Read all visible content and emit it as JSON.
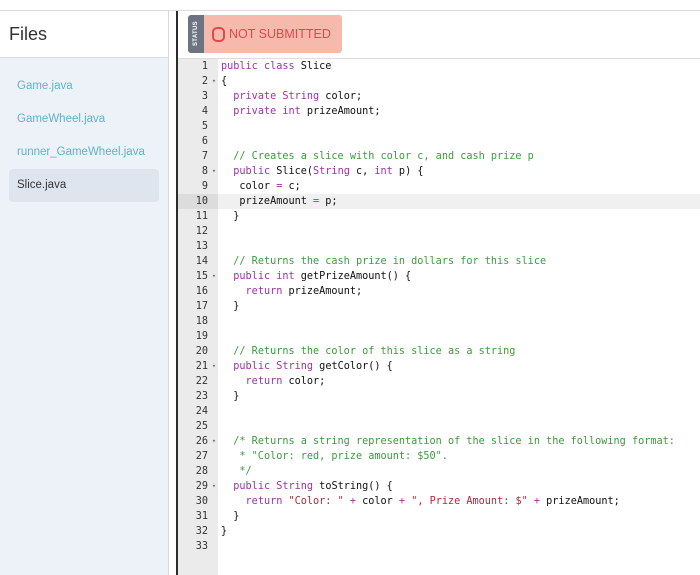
{
  "sidebar": {
    "title": "Files",
    "files": [
      {
        "name": "Game.java",
        "active": false
      },
      {
        "name": "GameWheel.java",
        "active": false
      },
      {
        "name": "runner_GameWheel.java",
        "active": false
      },
      {
        "name": "Slice.java",
        "active": true
      }
    ]
  },
  "status": {
    "label": "STATUS",
    "value": "NOT SUBMITTED",
    "icon": "circle-icon"
  },
  "editor": {
    "active_line": 10,
    "foldable_lines": [
      2,
      8,
      15,
      21,
      26,
      29
    ],
    "lines": [
      [
        [
          "kw",
          "public"
        ],
        [
          "t",
          " "
        ],
        [
          "kw",
          "class"
        ],
        [
          "t",
          " Slice"
        ]
      ],
      [
        [
          "t",
          "{"
        ]
      ],
      [
        [
          "t",
          "  "
        ],
        [
          "kw",
          "private"
        ],
        [
          "t",
          " "
        ],
        [
          "kw",
          "String"
        ],
        [
          "t",
          " color;"
        ]
      ],
      [
        [
          "t",
          "  "
        ],
        [
          "kw",
          "private"
        ],
        [
          "t",
          " "
        ],
        [
          "kw",
          "int"
        ],
        [
          "t",
          " prizeAmount;"
        ]
      ],
      [],
      [],
      [
        [
          "t",
          "  "
        ],
        [
          "cm",
          "// Creates a slice with color c, and cash prize p"
        ]
      ],
      [
        [
          "t",
          "  "
        ],
        [
          "kw",
          "public"
        ],
        [
          "t",
          " Slice("
        ],
        [
          "kw",
          "String"
        ],
        [
          "t",
          " c, "
        ],
        [
          "kw",
          "int"
        ],
        [
          "t",
          " p) {"
        ]
      ],
      [
        [
          "t",
          "   color "
        ],
        [
          "op",
          "="
        ],
        [
          "t",
          " c;"
        ]
      ],
      [
        [
          "t",
          "   prizeAmount "
        ],
        [
          "op",
          "="
        ],
        [
          "t",
          " p;"
        ]
      ],
      [
        [
          "t",
          "  }"
        ]
      ],
      [],
      [],
      [
        [
          "t",
          "  "
        ],
        [
          "cm",
          "// Returns the cash prize in dollars for this slice"
        ]
      ],
      [
        [
          "t",
          "  "
        ],
        [
          "kw",
          "public"
        ],
        [
          "t",
          " "
        ],
        [
          "kw",
          "int"
        ],
        [
          "t",
          " getPrizeAmount() {"
        ]
      ],
      [
        [
          "t",
          "    "
        ],
        [
          "kw",
          "return"
        ],
        [
          "t",
          " prizeAmount;"
        ]
      ],
      [
        [
          "t",
          "  }"
        ]
      ],
      [],
      [],
      [
        [
          "t",
          "  "
        ],
        [
          "cm",
          "// Returns the color of this slice as a string"
        ]
      ],
      [
        [
          "t",
          "  "
        ],
        [
          "kw",
          "public"
        ],
        [
          "t",
          " "
        ],
        [
          "kw",
          "String"
        ],
        [
          "t",
          " getColor() {"
        ]
      ],
      [
        [
          "t",
          "    "
        ],
        [
          "kw",
          "return"
        ],
        [
          "t",
          " color;"
        ]
      ],
      [
        [
          "t",
          "  }"
        ]
      ],
      [],
      [],
      [
        [
          "t",
          "  "
        ],
        [
          "cm",
          "/* Returns a string representation of the slice in the following format:"
        ]
      ],
      [
        [
          "t",
          "   "
        ],
        [
          "cm",
          "* \"Color: red, prize amount: $50\"."
        ]
      ],
      [
        [
          "t",
          "   "
        ],
        [
          "cm",
          "*/"
        ]
      ],
      [
        [
          "t",
          "  "
        ],
        [
          "kw",
          "public"
        ],
        [
          "t",
          " "
        ],
        [
          "kw",
          "String"
        ],
        [
          "t",
          " toString() {"
        ]
      ],
      [
        [
          "t",
          "    "
        ],
        [
          "kw",
          "return"
        ],
        [
          "t",
          " "
        ],
        [
          "str",
          "\"Color: \""
        ],
        [
          "t",
          " "
        ],
        [
          "op",
          "+"
        ],
        [
          "t",
          " color "
        ],
        [
          "op",
          "+"
        ],
        [
          "t",
          " "
        ],
        [
          "str",
          "\", Prize Amount: $\""
        ],
        [
          "t",
          " "
        ],
        [
          "op",
          "+"
        ],
        [
          "t",
          " prizeAmount;"
        ]
      ],
      [
        [
          "t",
          "  }"
        ]
      ],
      [
        [
          "t",
          "}"
        ]
      ],
      []
    ]
  }
}
